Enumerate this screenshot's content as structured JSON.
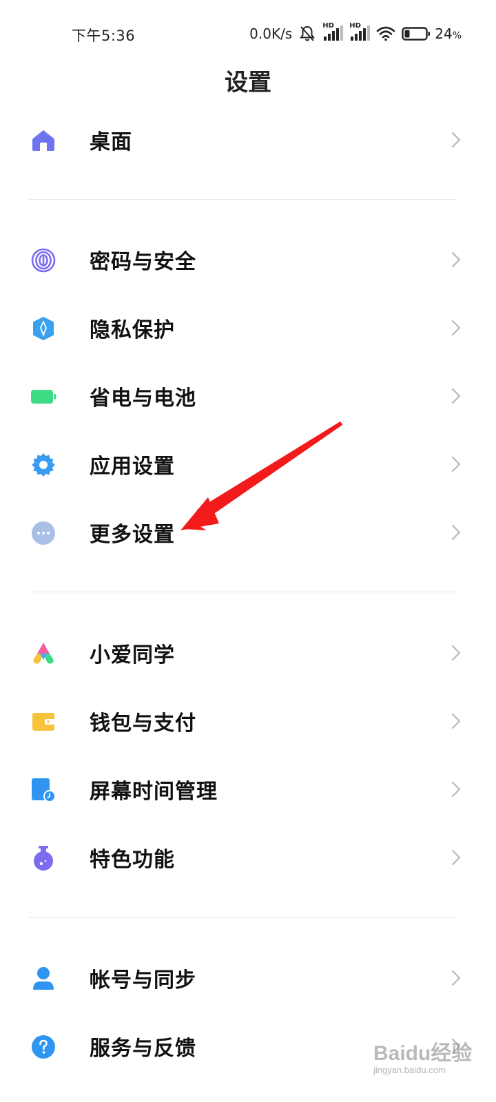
{
  "status_bar": {
    "time": "下午5:36",
    "net_speed": "0.0K/s",
    "signal_1_label": "HD",
    "signal_2_label": "HD",
    "battery_percent": "24",
    "battery_unit": "%",
    "battery_level": 0.24
  },
  "header": {
    "title": "设置"
  },
  "sections": [
    {
      "items": [
        {
          "label": "桌面",
          "icon": "home-icon",
          "color": "#6c74f0"
        }
      ]
    },
    {
      "items": [
        {
          "label": "密码与安全",
          "icon": "fingerprint-icon",
          "color": "#7a6cf0"
        },
        {
          "label": "隐私保护",
          "icon": "privacy-shield-icon",
          "color": "#3aa0f0"
        },
        {
          "label": "省电与电池",
          "icon": "battery-icon",
          "color": "#3ddc84"
        },
        {
          "label": "应用设置",
          "icon": "gear-icon",
          "color": "#3a9cf0"
        },
        {
          "label": "更多设置",
          "icon": "more-dots-icon",
          "color": "#a9bfe8"
        }
      ]
    },
    {
      "items": [
        {
          "label": "小爱同学",
          "icon": "xiaoai-icon",
          "color": "#f25fa5"
        },
        {
          "label": "钱包与支付",
          "icon": "wallet-icon",
          "color": "#f7c23c"
        },
        {
          "label": "屏幕时间管理",
          "icon": "screen-time-icon",
          "color": "#2f95f0"
        },
        {
          "label": "特色功能",
          "icon": "flask-icon",
          "color": "#7b6cf0"
        }
      ]
    },
    {
      "items": [
        {
          "label": "帐号与同步",
          "icon": "account-icon",
          "color": "#2f95f0"
        },
        {
          "label": "服务与反馈",
          "icon": "help-icon",
          "color": "#2f95f0"
        }
      ]
    }
  ],
  "watermark": {
    "brand": "Baidu经验",
    "site": "jingyan.baidu.com"
  }
}
